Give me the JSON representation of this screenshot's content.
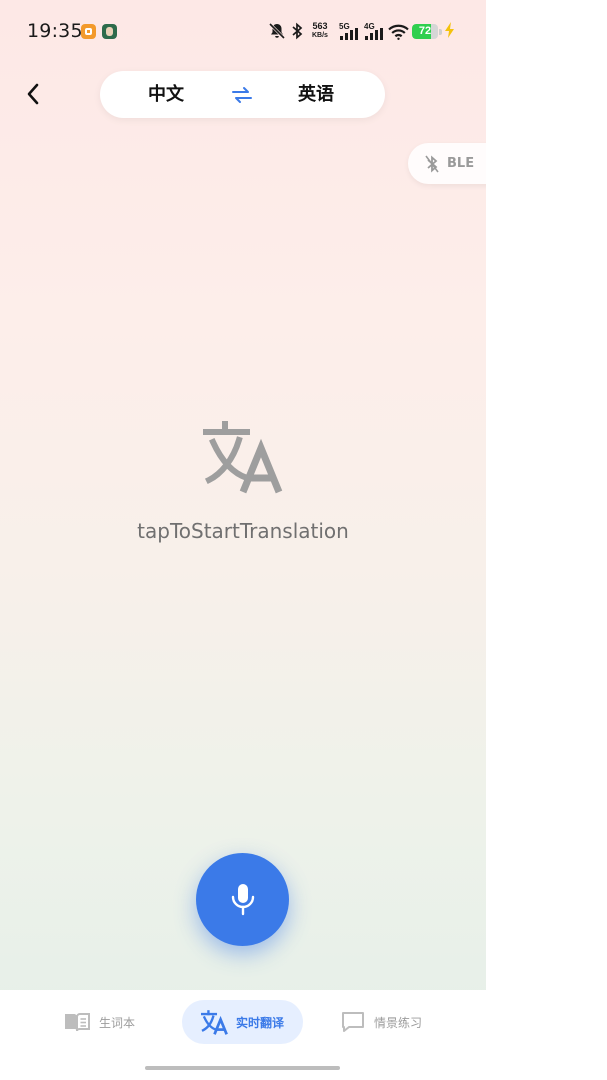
{
  "status_bar": {
    "time": "19:35",
    "net_speed_value": "563",
    "net_speed_unit": "KB/s",
    "net_5g": "5G",
    "net_4g": "4G",
    "battery_level": "72",
    "battery_fraction": 0.72
  },
  "header": {
    "source_language": "中文",
    "target_language": "英语"
  },
  "ble": {
    "label": "BLE"
  },
  "main": {
    "hint": "tapToStartTranslation"
  },
  "bottom_nav": {
    "items": [
      {
        "label": "生词本",
        "icon": "book-icon",
        "active": false
      },
      {
        "label": "实时翻译",
        "icon": "translate-icon",
        "active": true
      },
      {
        "label": "情景练习",
        "icon": "chat-icon",
        "active": false
      }
    ]
  },
  "colors": {
    "accent": "#3b7ae8",
    "battery": "#2fcf4e",
    "nav_active_bg": "#e6efff"
  }
}
